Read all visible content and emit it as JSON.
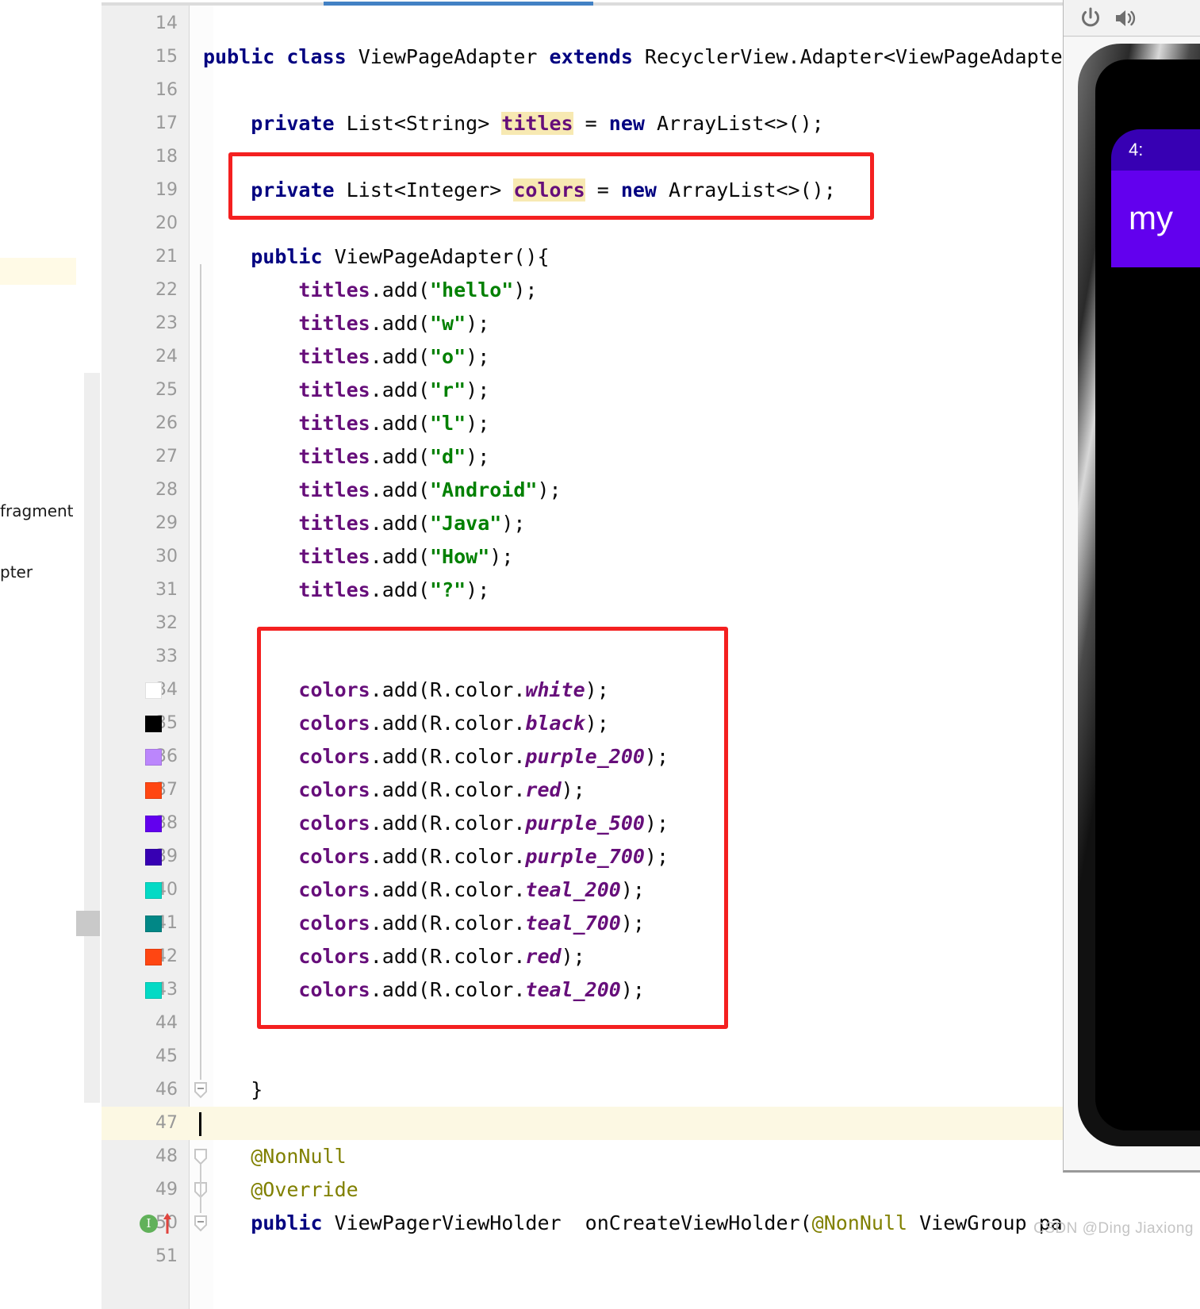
{
  "window": {
    "app": "Android Studio",
    "watermark": "CSDN @Ding Jiaxiong"
  },
  "sidebar": {
    "items": [
      {
        "label": "fragment"
      },
      {
        "label": "pter"
      }
    ]
  },
  "editor": {
    "first_line": 14,
    "current_line": 47,
    "lines": [
      {
        "n": 14,
        "indent": 0,
        "tokens": []
      },
      {
        "n": 15,
        "indent": 0,
        "tokens": [
          {
            "t": "public",
            "c": "kw"
          },
          {
            "t": " ",
            "c": "pln"
          },
          {
            "t": "class",
            "c": "kw"
          },
          {
            "t": " ViewPageAdapter ",
            "c": "pln"
          },
          {
            "t": "extends",
            "c": "kw"
          },
          {
            "t": " RecyclerView.Adapter<ViewPageAdapte",
            "c": "pln"
          }
        ]
      },
      {
        "n": 16,
        "indent": 0,
        "tokens": []
      },
      {
        "n": 17,
        "indent": 1,
        "tokens": [
          {
            "t": "private",
            "c": "kw"
          },
          {
            "t": " List<String> ",
            "c": "pln"
          },
          {
            "t": "titles",
            "c": "fld hl"
          },
          {
            "t": " = ",
            "c": "pln"
          },
          {
            "t": "new",
            "c": "kw"
          },
          {
            "t": " ArrayList<>();",
            "c": "pln"
          }
        ]
      },
      {
        "n": 18,
        "indent": 0,
        "tokens": []
      },
      {
        "n": 19,
        "indent": 1,
        "tokens": [
          {
            "t": "private",
            "c": "kw"
          },
          {
            "t": " List<Integer> ",
            "c": "pln"
          },
          {
            "t": "colors",
            "c": "fld hl"
          },
          {
            "t": " = ",
            "c": "pln"
          },
          {
            "t": "new",
            "c": "kw"
          },
          {
            "t": " ArrayList<>();",
            "c": "pln"
          }
        ]
      },
      {
        "n": 20,
        "indent": 0,
        "tokens": []
      },
      {
        "n": 21,
        "indent": 1,
        "tokens": [
          {
            "t": "public",
            "c": "kw"
          },
          {
            "t": " ViewPageAdapter(){",
            "c": "pln"
          }
        ]
      },
      {
        "n": 22,
        "indent": 2,
        "tokens": [
          {
            "t": "titles",
            "c": "fld"
          },
          {
            "t": ".add(",
            "c": "pln"
          },
          {
            "t": "\"hello\"",
            "c": "str"
          },
          {
            "t": ");",
            "c": "pln"
          }
        ]
      },
      {
        "n": 23,
        "indent": 2,
        "tokens": [
          {
            "t": "titles",
            "c": "fld"
          },
          {
            "t": ".add(",
            "c": "pln"
          },
          {
            "t": "\"w\"",
            "c": "str"
          },
          {
            "t": ");",
            "c": "pln"
          }
        ]
      },
      {
        "n": 24,
        "indent": 2,
        "tokens": [
          {
            "t": "titles",
            "c": "fld"
          },
          {
            "t": ".add(",
            "c": "pln"
          },
          {
            "t": "\"o\"",
            "c": "str"
          },
          {
            "t": ");",
            "c": "pln"
          }
        ]
      },
      {
        "n": 25,
        "indent": 2,
        "tokens": [
          {
            "t": "titles",
            "c": "fld"
          },
          {
            "t": ".add(",
            "c": "pln"
          },
          {
            "t": "\"r\"",
            "c": "str"
          },
          {
            "t": ");",
            "c": "pln"
          }
        ]
      },
      {
        "n": 26,
        "indent": 2,
        "tokens": [
          {
            "t": "titles",
            "c": "fld"
          },
          {
            "t": ".add(",
            "c": "pln"
          },
          {
            "t": "\"l\"",
            "c": "str"
          },
          {
            "t": ");",
            "c": "pln"
          }
        ]
      },
      {
        "n": 27,
        "indent": 2,
        "tokens": [
          {
            "t": "titles",
            "c": "fld"
          },
          {
            "t": ".add(",
            "c": "pln"
          },
          {
            "t": "\"d\"",
            "c": "str"
          },
          {
            "t": ");",
            "c": "pln"
          }
        ]
      },
      {
        "n": 28,
        "indent": 2,
        "tokens": [
          {
            "t": "titles",
            "c": "fld"
          },
          {
            "t": ".add(",
            "c": "pln"
          },
          {
            "t": "\"Android\"",
            "c": "str"
          },
          {
            "t": ");",
            "c": "pln"
          }
        ]
      },
      {
        "n": 29,
        "indent": 2,
        "tokens": [
          {
            "t": "titles",
            "c": "fld"
          },
          {
            "t": ".add(",
            "c": "pln"
          },
          {
            "t": "\"Java\"",
            "c": "str"
          },
          {
            "t": ");",
            "c": "pln"
          }
        ]
      },
      {
        "n": 30,
        "indent": 2,
        "tokens": [
          {
            "t": "titles",
            "c": "fld"
          },
          {
            "t": ".add(",
            "c": "pln"
          },
          {
            "t": "\"How\"",
            "c": "str"
          },
          {
            "t": ");",
            "c": "pln"
          }
        ]
      },
      {
        "n": 31,
        "indent": 2,
        "tokens": [
          {
            "t": "titles",
            "c": "fld"
          },
          {
            "t": ".add(",
            "c": "pln"
          },
          {
            "t": "\"?\"",
            "c": "str"
          },
          {
            "t": ");",
            "c": "pln"
          }
        ]
      },
      {
        "n": 32,
        "indent": 0,
        "tokens": []
      },
      {
        "n": 33,
        "indent": 0,
        "tokens": []
      },
      {
        "n": 34,
        "indent": 2,
        "swatch": "#ffffff",
        "tokens": [
          {
            "t": "colors",
            "c": "fld"
          },
          {
            "t": ".add(R.color.",
            "c": "pln"
          },
          {
            "t": "white",
            "c": "fldi"
          },
          {
            "t": ");",
            "c": "pln"
          }
        ]
      },
      {
        "n": 35,
        "indent": 2,
        "swatch": "#000000",
        "tokens": [
          {
            "t": "colors",
            "c": "fld"
          },
          {
            "t": ".add(R.color.",
            "c": "pln"
          },
          {
            "t": "black",
            "c": "fldi"
          },
          {
            "t": ");",
            "c": "pln"
          }
        ]
      },
      {
        "n": 36,
        "indent": 2,
        "swatch": "#bb86fc",
        "tokens": [
          {
            "t": "colors",
            "c": "fld"
          },
          {
            "t": ".add(R.color.",
            "c": "pln"
          },
          {
            "t": "purple_200",
            "c": "fldi"
          },
          {
            "t": ");",
            "c": "pln"
          }
        ]
      },
      {
        "n": 37,
        "indent": 2,
        "swatch": "#ff4612",
        "tokens": [
          {
            "t": "colors",
            "c": "fld"
          },
          {
            "t": ".add(R.color.",
            "c": "pln"
          },
          {
            "t": "red",
            "c": "fldi"
          },
          {
            "t": ");",
            "c": "pln"
          }
        ]
      },
      {
        "n": 38,
        "indent": 2,
        "swatch": "#6200ee",
        "tokens": [
          {
            "t": "colors",
            "c": "fld"
          },
          {
            "t": ".add(R.color.",
            "c": "pln"
          },
          {
            "t": "purple_500",
            "c": "fldi"
          },
          {
            "t": ");",
            "c": "pln"
          }
        ]
      },
      {
        "n": 39,
        "indent": 2,
        "swatch": "#3700b3",
        "tokens": [
          {
            "t": "colors",
            "c": "fld"
          },
          {
            "t": ".add(R.color.",
            "c": "pln"
          },
          {
            "t": "purple_700",
            "c": "fldi"
          },
          {
            "t": ");",
            "c": "pln"
          }
        ]
      },
      {
        "n": 40,
        "indent": 2,
        "swatch": "#03dac5",
        "tokens": [
          {
            "t": "colors",
            "c": "fld"
          },
          {
            "t": ".add(R.color.",
            "c": "pln"
          },
          {
            "t": "teal_200",
            "c": "fldi"
          },
          {
            "t": ");",
            "c": "pln"
          }
        ]
      },
      {
        "n": 41,
        "indent": 2,
        "swatch": "#018786",
        "tokens": [
          {
            "t": "colors",
            "c": "fld"
          },
          {
            "t": ".add(R.color.",
            "c": "pln"
          },
          {
            "t": "teal_700",
            "c": "fldi"
          },
          {
            "t": ");",
            "c": "pln"
          }
        ]
      },
      {
        "n": 42,
        "indent": 2,
        "swatch": "#ff4612",
        "tokens": [
          {
            "t": "colors",
            "c": "fld"
          },
          {
            "t": ".add(R.color.",
            "c": "pln"
          },
          {
            "t": "red",
            "c": "fldi"
          },
          {
            "t": ");",
            "c": "pln"
          }
        ]
      },
      {
        "n": 43,
        "indent": 2,
        "swatch": "#03dac5",
        "tokens": [
          {
            "t": "colors",
            "c": "fld"
          },
          {
            "t": ".add(R.color.",
            "c": "pln"
          },
          {
            "t": "teal_200",
            "c": "fldi"
          },
          {
            "t": ");",
            "c": "pln"
          }
        ]
      },
      {
        "n": 44,
        "indent": 0,
        "tokens": []
      },
      {
        "n": 45,
        "indent": 0,
        "tokens": []
      },
      {
        "n": 46,
        "indent": 1,
        "fold": "collapse",
        "tokens": [
          {
            "t": "}",
            "c": "pln"
          }
        ]
      },
      {
        "n": 47,
        "indent": 0,
        "current": true,
        "tokens": []
      },
      {
        "n": 48,
        "indent": 1,
        "fold": "annotation",
        "tokens": [
          {
            "t": "@NonNull",
            "c": "ann"
          }
        ]
      },
      {
        "n": 49,
        "indent": 1,
        "fold": "annotation",
        "tokens": [
          {
            "t": "@Override",
            "c": "ann"
          }
        ]
      },
      {
        "n": 50,
        "indent": 1,
        "fold": "collapse",
        "run": true,
        "tokens": [
          {
            "t": "public",
            "c": "kw"
          },
          {
            "t": " ViewPagerViewHolder  onCreateViewHolder(",
            "c": "pln"
          },
          {
            "t": "@NonNull",
            "c": "ann"
          },
          {
            "t": " ViewGroup parent,",
            "c": "pln"
          }
        ]
      },
      {
        "n": 51,
        "indent": 2,
        "tokens": [
          {
            "t": "        ",
            "c": "pln"
          }
        ]
      }
    ]
  },
  "emulator": {
    "toolbar": {
      "power_icon": "power-icon",
      "volume_icon": "volume-icon"
    },
    "device": {
      "status_time": "4:",
      "app_title": "my",
      "appbar_color": "#6200ee",
      "statusbar_color": "#3700b3"
    }
  },
  "annotations": {
    "boxes": [
      {
        "name": "colors-declaration-highlight",
        "color": "#f42020"
      },
      {
        "name": "colors-block-highlight",
        "color": "#f42020"
      }
    ]
  }
}
